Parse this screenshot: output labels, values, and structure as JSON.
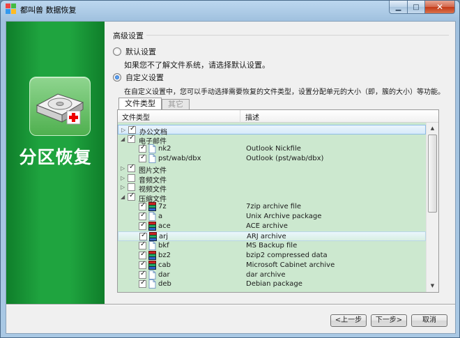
{
  "window": {
    "title": "都叫兽 数据恢复"
  },
  "banner": {
    "title": "分区恢复"
  },
  "section": {
    "title": "高级设置"
  },
  "options": {
    "default": {
      "label": "默认设置",
      "desc": "如果您不了解文件系统，请选择默认设置。",
      "checked": false
    },
    "custom": {
      "label": "自定义设置",
      "desc": "在自定义设置中，您可以手动选择需要恢复的文件类型，设置分配单元的大小（即，簇的大小）等功能。",
      "checked": true
    }
  },
  "tabs": [
    {
      "label": "文件类型",
      "active": true
    },
    {
      "label": "其它",
      "active": false
    }
  ],
  "table": {
    "columns": [
      "文件类型",
      "描述"
    ],
    "rows": [
      {
        "level": 0,
        "expander": "collapsed",
        "checked": true,
        "name": "办公文档",
        "desc": "",
        "state": "selected"
      },
      {
        "level": 0,
        "expander": "expanded",
        "checked": true,
        "name": "电子邮件",
        "desc": ""
      },
      {
        "level": 1,
        "checked": true,
        "icon": "file-icon",
        "name": "nk2",
        "desc": "Outlook Nickfile"
      },
      {
        "level": 1,
        "checked": true,
        "icon": "file-icon",
        "name": "pst/wab/dbx",
        "desc": "Outlook (pst/wab/dbx)"
      },
      {
        "level": 0,
        "expander": "collapsed",
        "checked": true,
        "name": "图片文件",
        "desc": ""
      },
      {
        "level": 0,
        "expander": "collapsed",
        "checked": false,
        "name": "音频文件",
        "desc": ""
      },
      {
        "level": 0,
        "expander": "collapsed",
        "checked": false,
        "name": "视频文件",
        "desc": ""
      },
      {
        "level": 0,
        "expander": "expanded",
        "checked": true,
        "name": "压缩文件",
        "desc": ""
      },
      {
        "level": 1,
        "checked": true,
        "icon": "archive-icon",
        "name": "7z",
        "desc": "7zip archive file"
      },
      {
        "level": 1,
        "checked": true,
        "icon": "file-icon",
        "name": "a",
        "desc": "Unix Archive package"
      },
      {
        "level": 1,
        "checked": true,
        "icon": "archive-icon",
        "name": "ace",
        "desc": "ACE archive"
      },
      {
        "level": 1,
        "checked": true,
        "icon": "archive-icon",
        "name": "arj",
        "desc": "ARJ archive",
        "state": "hover"
      },
      {
        "level": 1,
        "checked": true,
        "icon": "file-icon",
        "name": "bkf",
        "desc": "MS Backup file"
      },
      {
        "level": 1,
        "checked": true,
        "icon": "archive-icon",
        "name": "bz2",
        "desc": "bzip2 compressed data"
      },
      {
        "level": 1,
        "checked": true,
        "icon": "archive-icon",
        "name": "cab",
        "desc": "Microsoft Cabinet archive"
      },
      {
        "level": 1,
        "checked": true,
        "icon": "file-icon",
        "name": "dar",
        "desc": "dar archive"
      },
      {
        "level": 1,
        "checked": true,
        "icon": "file-icon",
        "name": "deb",
        "desc": "Debian package"
      }
    ]
  },
  "buttons": {
    "prev": "<上一步",
    "next": "下一步>",
    "cancel": "取消"
  }
}
